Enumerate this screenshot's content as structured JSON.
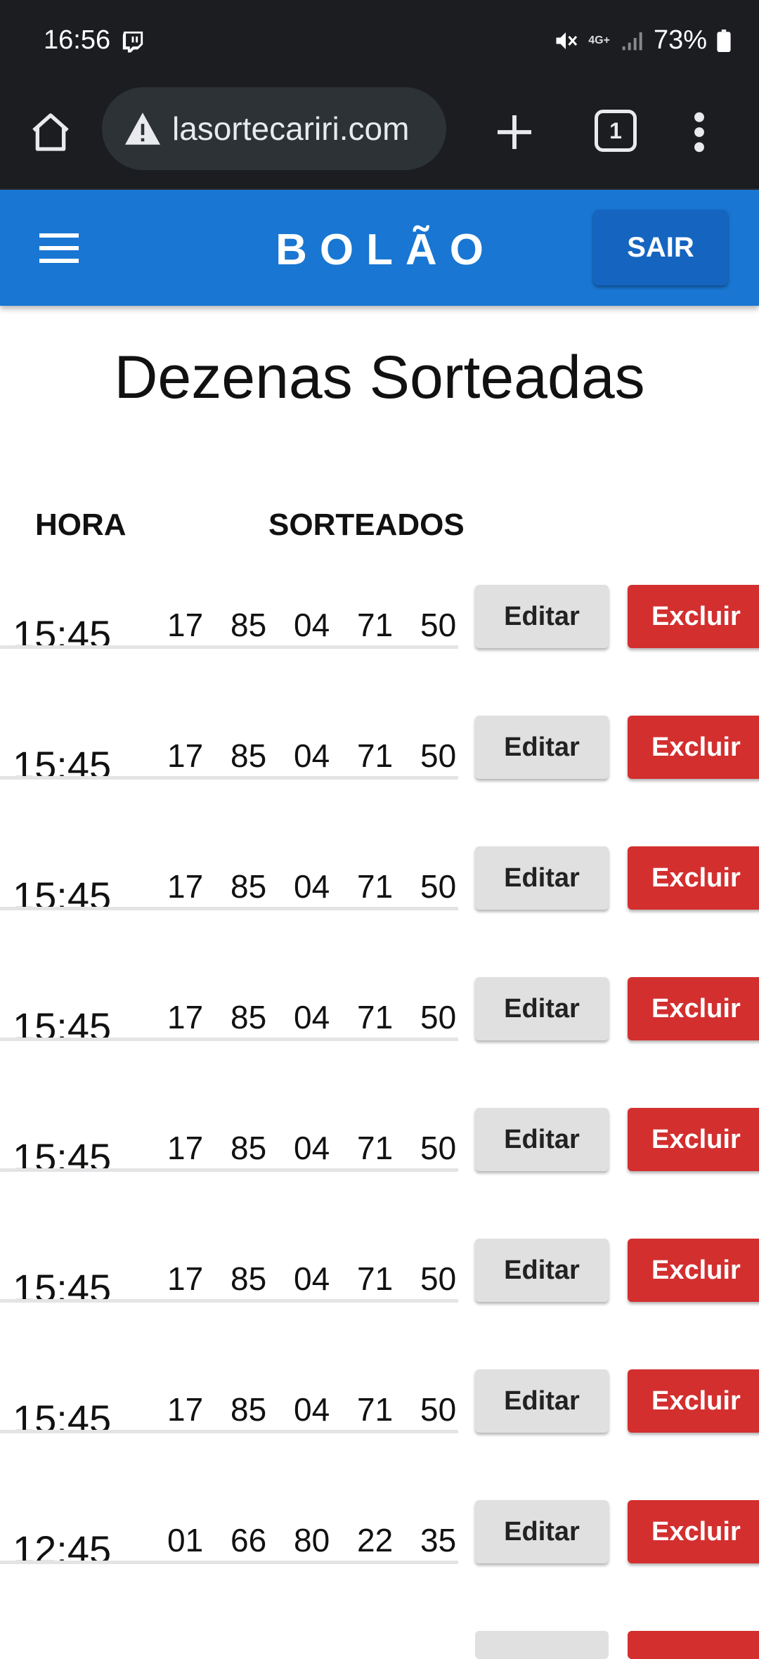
{
  "status_bar": {
    "time": "16:56",
    "network": "4G+",
    "battery": "73%"
  },
  "browser": {
    "url": "lasortecariri.com",
    "tab_count": "1"
  },
  "app_bar": {
    "title": "BOLÃO",
    "logout_label": "SAIR"
  },
  "page": {
    "title": "Dezenas Sorteadas"
  },
  "table": {
    "headers": {
      "hora": "HORA",
      "sorteados": "SORTEADOS"
    },
    "rows": [
      {
        "time": "15:45",
        "numbers": [
          "17",
          "85",
          "04",
          "71",
          "50"
        ]
      },
      {
        "time": "15:45",
        "numbers": [
          "17",
          "85",
          "04",
          "71",
          "50"
        ]
      },
      {
        "time": "15:45",
        "numbers": [
          "17",
          "85",
          "04",
          "71",
          "50"
        ]
      },
      {
        "time": "15:45",
        "numbers": [
          "17",
          "85",
          "04",
          "71",
          "50"
        ]
      },
      {
        "time": "15:45",
        "numbers": [
          "17",
          "85",
          "04",
          "71",
          "50"
        ]
      },
      {
        "time": "15:45",
        "numbers": [
          "17",
          "85",
          "04",
          "71",
          "50"
        ]
      },
      {
        "time": "15:45",
        "numbers": [
          "17",
          "85",
          "04",
          "71",
          "50"
        ]
      },
      {
        "time": "12:45",
        "numbers": [
          "01",
          "66",
          "80",
          "22",
          "35"
        ]
      }
    ],
    "edit_label": "Editar",
    "delete_label": "Excluir"
  },
  "colors": {
    "app_bar": "#1976d2",
    "delete_button": "#d32f2f",
    "edit_button": "#e0e0e0",
    "system_bar": "#1b1d21"
  }
}
